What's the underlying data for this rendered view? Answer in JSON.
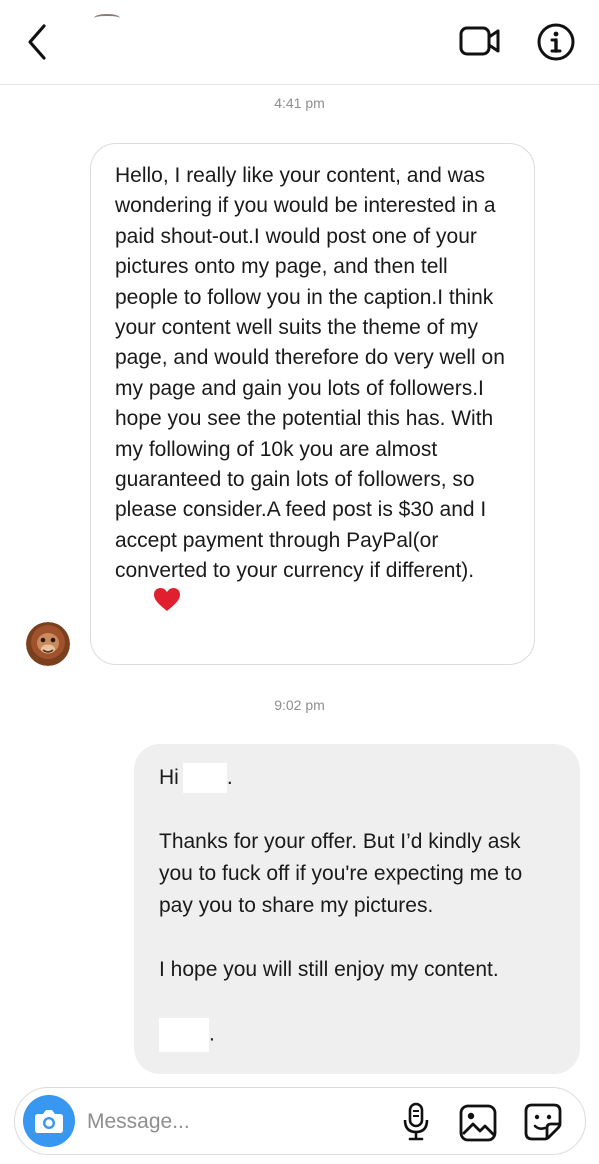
{
  "header": {
    "icons": {
      "back": "chevron-left-icon",
      "video": "video-camera-icon",
      "info": "info-icon"
    }
  },
  "thread": {
    "timestamps": [
      "4:41 pm",
      "9:02 pm"
    ],
    "incoming": {
      "text": "Hello, I really like your content, and was wondering if you would be interested in a paid shout-out.I would post one of your pictures onto my page, and then tell people to follow you in the caption.I think your content well suits the theme of my page, and would therefore do very well on my page and gain you lots of followers.I hope you see the potential this has. With my following of 10k you are almost guaranteed to gain lots of followers, so please consider.A feed post is $30 and I accept payment through PayPal(or converted to your currency if different).",
      "emoji": "heart-emoji",
      "heart_color": "#e0202e"
    },
    "outgoing": {
      "greeting": "Hi",
      "greeting_end": ".",
      "paragraph1": "Thanks for your offer. But I’d kindly ask you to fuck off if you're expecting me to pay you to share my pictures.",
      "paragraph2": "I hope you will still enjoy my content.",
      "signoff_end": "."
    }
  },
  "composer": {
    "placeholder": "Message...",
    "icons": {
      "camera": "camera-icon",
      "mic": "microphone-icon",
      "gallery": "gallery-icon",
      "sticker": "sticker-icon"
    },
    "accent_color": "#3897f0"
  },
  "colors": {
    "outgoing_bubble": "#efefef",
    "timestamp": "#8e8e8e"
  }
}
